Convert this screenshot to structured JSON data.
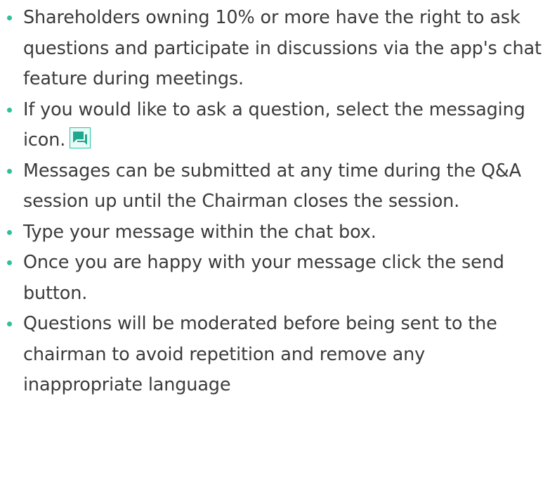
{
  "instructions": {
    "items": [
      {
        "text": "Shareholders owning 10% or more have the right to ask questions and participate in discussions via the app's chat feature during meetings."
      },
      {
        "text": "If you would like to ask a question, select the messaging icon.",
        "icon": "chat-bubbles-icon"
      },
      {
        "text": "Messages can be submitted at any time during the Q&A session up until the Chairman closes the session."
      },
      {
        "text": "Type your message within the chat box."
      },
      {
        "text": "Once you are happy with your message click the send button."
      },
      {
        "text": "Questions will be moderated before being sent to the chairman to avoid repetition and remove any inappropriate language"
      }
    ]
  },
  "colors": {
    "text": "#3b3b3b",
    "bullet": "#2fbf9b",
    "icon_border": "#22c3a6",
    "icon_fill": "#1fa88f"
  }
}
